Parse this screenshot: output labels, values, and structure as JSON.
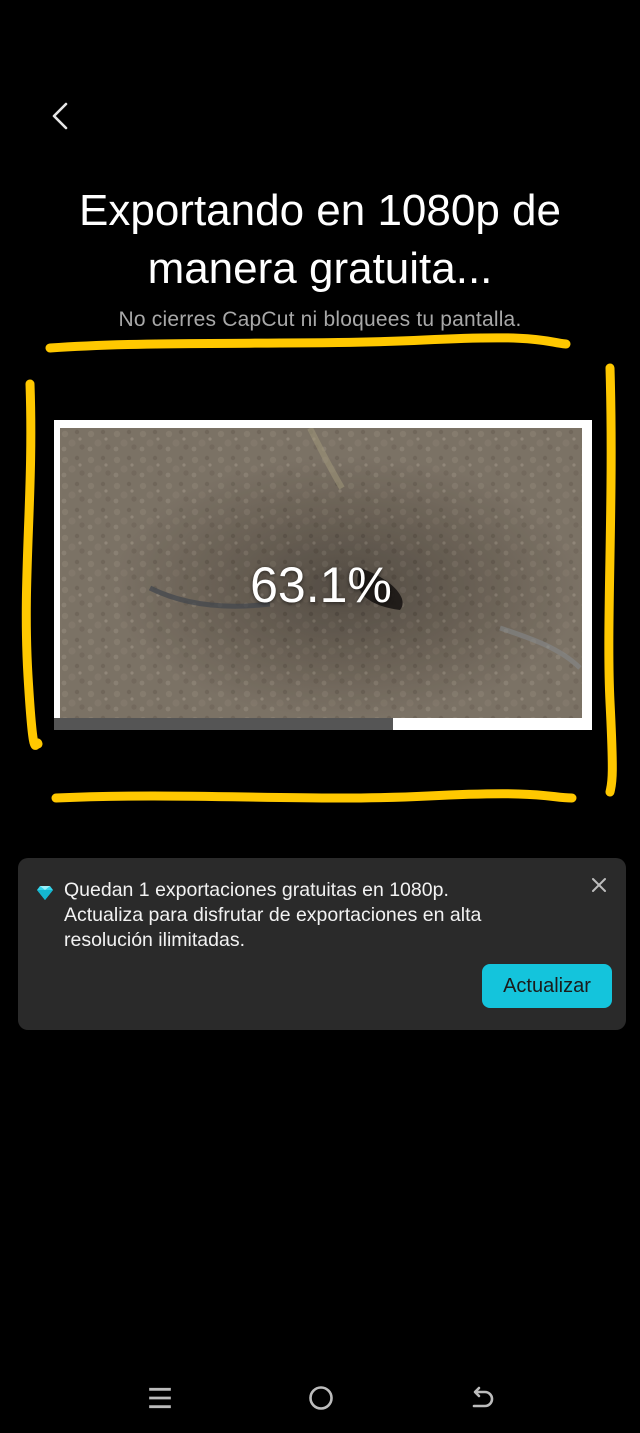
{
  "header": {
    "back_icon": "chevron-left-icon",
    "title_line1": "Exportando en 1080p de",
    "title_line2": "manera gratuita...",
    "subtitle": "No cierres CapCut ni bloquees tu pantalla."
  },
  "export": {
    "percent_label": "63.1%",
    "progress": 0.631
  },
  "banner": {
    "icon": "diamond-icon",
    "line1": "Quedan 1 exportaciones gratuitas en 1080p.",
    "line2": "Actualiza para disfrutar de exportaciones en alta",
    "line3": "resolución ilimitadas.",
    "close_icon": "close-icon",
    "upgrade_label": "Actualizar"
  },
  "colors": {
    "background": "#000000",
    "accent": "#14c4dc",
    "highlight_marker": "#ffc800",
    "banner_bg": "#2a2a2a"
  },
  "navbar": {
    "icons": [
      "menu-icon",
      "home-icon",
      "back-arrow-icon"
    ]
  }
}
